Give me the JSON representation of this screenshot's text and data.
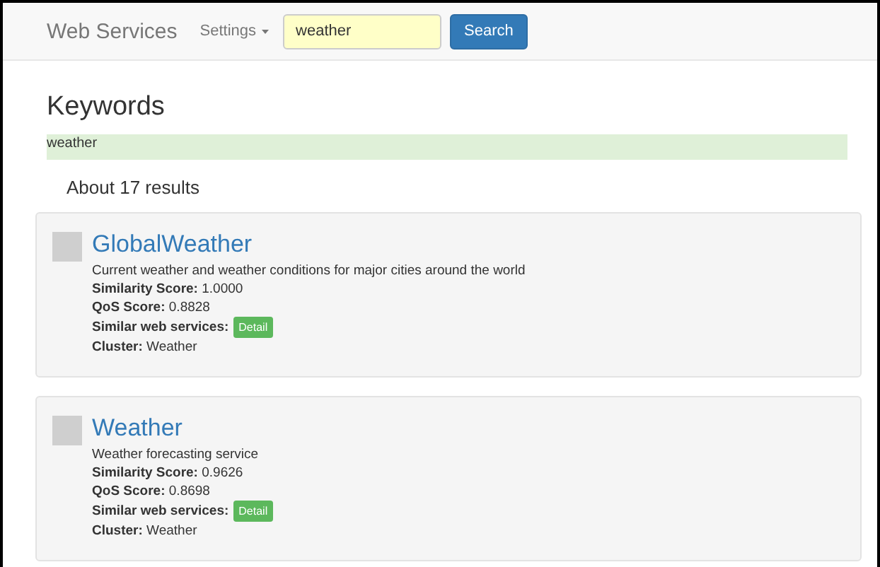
{
  "navbar": {
    "brand": "Web Services",
    "menu": "Settings",
    "search": {
      "value": "weather",
      "button": "Search"
    }
  },
  "keywords": {
    "heading": "Keywords",
    "terms": "weather"
  },
  "result_count": "About 17 results",
  "results": [
    {
      "title": "GlobalWeather",
      "description": "Current weather and weather conditions for major cities around the world",
      "fields": [
        {
          "kind": "text",
          "label": "Similarity Score:",
          "value": "1.0000"
        },
        {
          "kind": "text",
          "label": "QoS Score:",
          "value": "0.8828"
        },
        {
          "kind": "button",
          "label": "Similar web services:",
          "value": "Detail"
        },
        {
          "kind": "text",
          "label": "Cluster:",
          "value": "Weather"
        }
      ]
    },
    {
      "title": "Weather",
      "description": "Weather forecasting service",
      "fields": [
        {
          "kind": "text",
          "label": "Similarity Score:",
          "value": "0.9626"
        },
        {
          "kind": "text",
          "label": "QoS Score:",
          "value": "0.8698"
        },
        {
          "kind": "button",
          "label": "Similar web services:",
          "value": "Detail"
        },
        {
          "kind": "text",
          "label": "Cluster:",
          "value": "Weather"
        }
      ]
    }
  ]
}
